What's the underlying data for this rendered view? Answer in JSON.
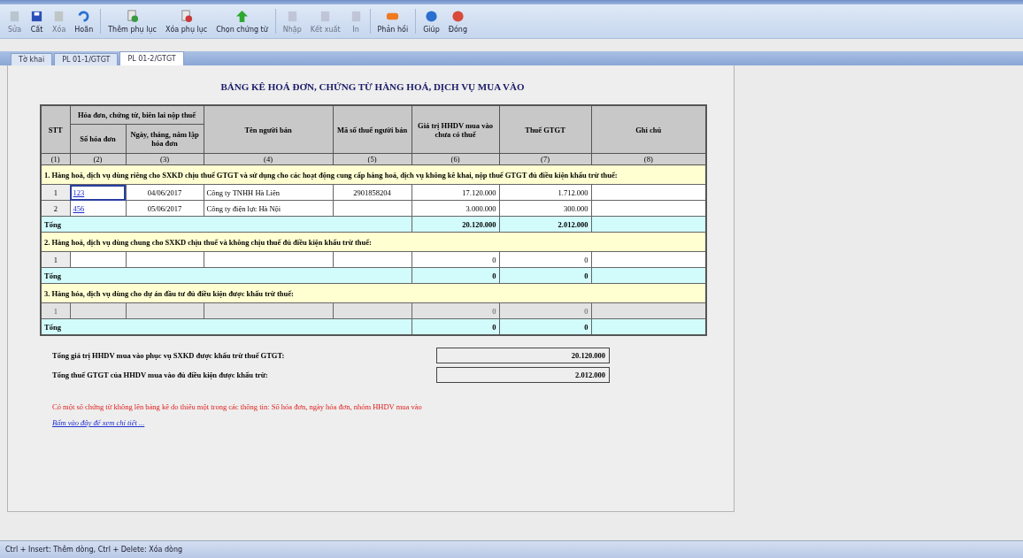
{
  "toolbar": [
    {
      "label": "Sửa",
      "disabled": true
    },
    {
      "label": "Cất",
      "disabled": false
    },
    {
      "label": "Xóa",
      "disabled": true
    },
    {
      "label": "Hoãn",
      "disabled": false
    },
    {
      "label": "Thêm phụ lục",
      "disabled": false
    },
    {
      "label": "Xóa phụ lục",
      "disabled": false
    },
    {
      "label": "Chọn chứng từ",
      "disabled": false
    },
    {
      "label": "Nhập",
      "disabled": true
    },
    {
      "label": "Kết xuất",
      "disabled": true
    },
    {
      "label": "In",
      "disabled": true
    },
    {
      "label": "Phản hồi",
      "disabled": false
    },
    {
      "label": "Giúp",
      "disabled": false
    },
    {
      "label": "Đóng",
      "disabled": false
    }
  ],
  "tabs": [
    {
      "label": "Tờ khai",
      "selected": false
    },
    {
      "label": "PL 01-1/GTGT",
      "selected": false
    },
    {
      "label": "PL 01-2/GTGT",
      "selected": true
    }
  ],
  "form": {
    "title": "BẢNG KÊ HOÁ ĐƠN, CHỨNG TỪ HÀNG HOÁ, DỊCH VỤ MUA VÀO",
    "columns": {
      "stt": "STT",
      "group": "Hóa đơn, chứng từ, biên lai nộp thuế",
      "invoice_no": "Số hóa đơn",
      "date": "Ngày, tháng, năm lập hóa đơn",
      "seller": "Tên người bán",
      "tax_code": "Mã số thuế người bán",
      "value": "Giá trị HHDV mua vào chưa có thuế",
      "vat": "Thuế GTGT",
      "note": "Ghi chú"
    },
    "column_numbers": [
      "(1)",
      "(2)",
      "(3)",
      "(4)",
      "(5)",
      "(6)",
      "(7)",
      "(8)"
    ],
    "sections": [
      {
        "title": "1. Hàng hoá, dịch vụ dùng riêng cho SXKD chịu thuế GTGT và sử dụng cho các hoạt động cung cấp hàng hoá, dịch vụ không kê khai, nộp thuế GTGT đủ điều kiện khấu trừ thuế:",
        "rows": [
          {
            "stt": "1",
            "invoice_no": "123",
            "date": "04/06/2017",
            "seller": "Công ty TNHH Hà Liên",
            "tax_code": "2901858204",
            "value": "17.120.000",
            "vat": "1.712.000",
            "disabled": false,
            "selected": true
          },
          {
            "stt": "2",
            "invoice_no": "456",
            "date": "05/06/2017",
            "seller": "Công ty điện lực Hà Nội",
            "value": "3.000.000",
            "vat": "300.000",
            "disabled": false,
            "selected": false
          }
        ],
        "total": {
          "label": "Tổng",
          "value": "20.120.000",
          "vat": "2.012.000"
        }
      },
      {
        "title": "2. Hàng hoá, dịch vụ dùng chung cho SXKD chịu thuế và không chịu thuế đủ điều kiện khấu trừ thuế:",
        "rows": [
          {
            "stt": "1",
            "value": "0",
            "vat": "0",
            "disabled": false,
            "selected": false
          }
        ],
        "total": {
          "label": "Tổng",
          "value": "0",
          "vat": "0"
        }
      },
      {
        "title": "3. Hàng hóa, dịch vụ dùng cho dự án đầu tư đủ điều kiện được khấu trừ thuế:",
        "rows": [
          {
            "stt": "1",
            "value": "0",
            "vat": "0",
            "disabled": true,
            "selected": false
          }
        ],
        "total": {
          "label": "Tổng",
          "value": "0",
          "vat": "0"
        }
      }
    ],
    "summary": [
      {
        "label": "Tổng giá trị HHDV mua vào phục vụ SXKD được khấu trừ thuế GTGT:",
        "value": "20.120.000"
      },
      {
        "label": "Tổng thuế GTGT của HHDV mua vào đủ điều kiện được khấu trừ:",
        "value": "2.012.000"
      }
    ],
    "warning": "Có một số chứng từ không lên bảng kê do thiếu một trong các thông tin: Số hóa đơn, ngày hóa đơn, nhóm HHDV mua vào",
    "details_link": "Bấm vào đây để xem chi tiết ..."
  },
  "status_bar": "Ctrl + Insert: Thêm dòng, Ctrl + Delete: Xóa dòng"
}
